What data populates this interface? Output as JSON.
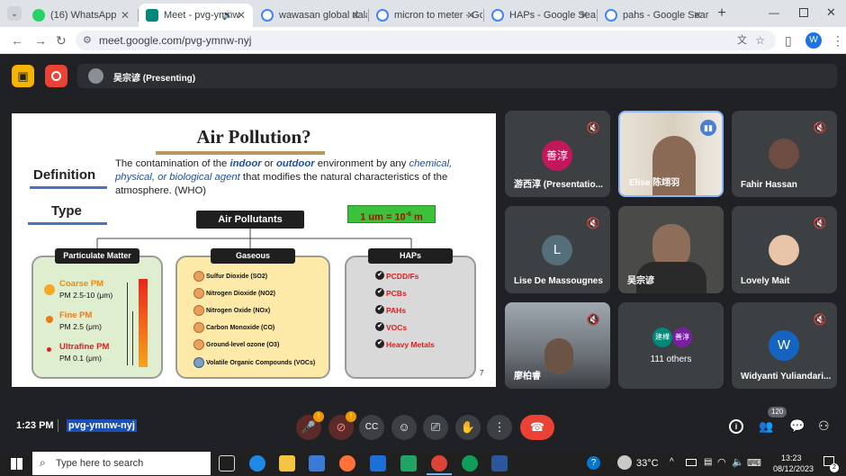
{
  "tabs": [
    {
      "title": "(16) WhatsApp",
      "color": "#25d366"
    },
    {
      "title": "Meet - pvg-ymnw",
      "color": "#00897b"
    },
    {
      "title": "wawasan global dala",
      "color": "#4285f4"
    },
    {
      "title": "micron to meter - Go",
      "color": "#4285f4"
    },
    {
      "title": "HAPs - Google Searc",
      "color": "#4285f4"
    },
    {
      "title": "pahs - Google Search",
      "color": "#4285f4"
    }
  ],
  "url": "meet.google.com/pvg-ymnw-nyj",
  "profile_initial": "W",
  "presenter_label": "吴宗谚 (Presenting)",
  "slide": {
    "title": "Air Pollution?",
    "definition_label": "Definition",
    "definition_text_1": "The contamination of the ",
    "definition_indoor": "indoor",
    "definition_or": " or ",
    "definition_outdoor": "outdoor",
    "definition_text_2": " environment by any ",
    "definition_agents": "chemical, physical, or biological agent",
    "definition_text_3": " that modifies the natural characteristics of the atmosphere. (WHO)",
    "type_label": "Type",
    "air_pollutants": "Air Pollutants",
    "unit_note_base": "1 um = 10",
    "unit_note_exp": "-6",
    "unit_note_unit": " m",
    "pm_header": "Particulate Matter",
    "pm_items": [
      {
        "name": "Coarse PM",
        "sub": "PM 2.5-10 (μm)"
      },
      {
        "name": "Fine PM",
        "sub": "PM 2.5 (μm)"
      },
      {
        "name": "Ultrafine PM",
        "sub": "PM 0.1 (μm)"
      }
    ],
    "gas_header": "Gaseous",
    "gas_items": [
      "Sulfur Dioxide (SO2)",
      "Nitrogen Dioxide (NO2)",
      "Nitrogen Oxide (NOx)",
      "Carbon Monoxide (CO)",
      "Ground-level ozone (O3)",
      "Volatile Organic Compounds (VOCs)"
    ],
    "haps_header": "HAPs",
    "haps_items": [
      "PCDD/Fs",
      "PCBs",
      "PAHs",
      "VOCs",
      "Heavy Metals"
    ],
    "page_number": "7"
  },
  "participants": [
    {
      "name": "游西淳 (Presentatio...",
      "avatar_text": "善淳",
      "avatar_color": "#c2185b"
    },
    {
      "name": "Elise 陈翊羽",
      "avatar_text": "",
      "avatar_color": "#8d6e63"
    },
    {
      "name": "Fahir Hassan",
      "avatar_text": "",
      "avatar_color": "#5d4037"
    },
    {
      "name": "Lise De Massougnes",
      "avatar_text": "L",
      "avatar_color": "#546e7a"
    },
    {
      "name": "吴宗谚",
      "avatar_text": "",
      "avatar_color": "#333"
    },
    {
      "name": "Lovely Mait",
      "avatar_text": "",
      "avatar_color": "#e8c4a8"
    },
    {
      "name": "廖柏睿",
      "avatar_text": "",
      "avatar_color": "#555"
    },
    {
      "name": "111 others",
      "avatar_text": "",
      "avatar_color": "#3c4043"
    },
    {
      "name": "Widyanti Yuliandari...",
      "avatar_text": "W",
      "avatar_color": "#1565c0"
    }
  ],
  "others_avatars": [
    "建樺",
    "善淳"
  ],
  "bottom": {
    "time": "1:23 PM",
    "meeting_code": "pvg-ymnw-nyj",
    "mic_badge": "!",
    "cam_badge": "!",
    "people_count": "120"
  },
  "taskbar": {
    "search_placeholder": "Type here to search",
    "temperature": "33°C",
    "clock_time": "13:23",
    "clock_date": "08/12/2023",
    "notification_count": "2"
  }
}
